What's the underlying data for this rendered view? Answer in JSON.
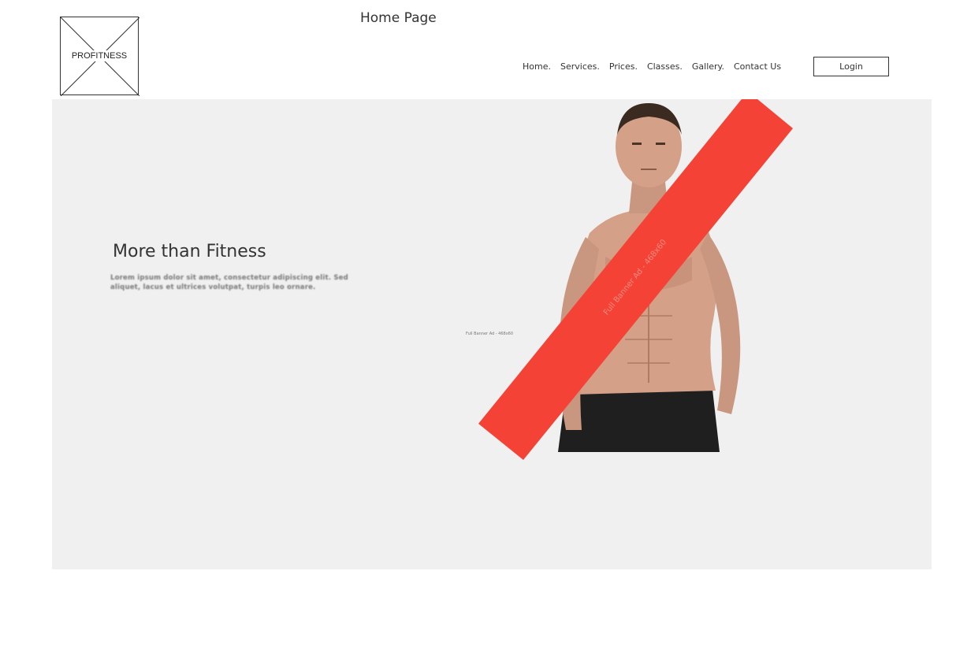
{
  "logo": {
    "text": "PROFITNESS"
  },
  "header": {
    "page_title": "Home Page"
  },
  "nav": {
    "items": [
      {
        "label": "Home."
      },
      {
        "label": "Services."
      },
      {
        "label": "Prices."
      },
      {
        "label": "Classes."
      },
      {
        "label": "Gallery."
      },
      {
        "label": "Contact Us"
      }
    ],
    "login_label": "Login"
  },
  "hero": {
    "heading": "More than Fitness",
    "description": "Lorem ipsum dolor sit amet, consectetur adipiscing elit. Sed aliquet, lacus et ultrices volutpat, turpis leo ornare.",
    "ad_label_small": "Full Banner Ad - 468x60",
    "ad_label_diagonal": "Full Banner Ad - 468x60"
  },
  "colors": {
    "hero_background": "#f0f0f0",
    "ad_banner": "#f44336"
  }
}
